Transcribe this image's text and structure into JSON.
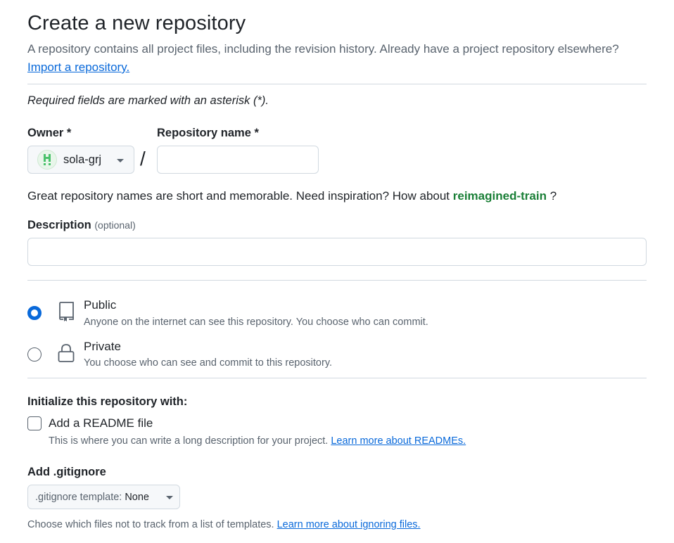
{
  "header": {
    "title": "Create a new repository",
    "subtitle": "A repository contains all project files, including the revision history. Already have a project repository elsewhere?",
    "import_link": "Import a repository."
  },
  "required_note": "Required fields are marked with an asterisk (*).",
  "owner": {
    "label": "Owner *",
    "value": "sola-grj",
    "avatar_color": "#4ac26b"
  },
  "separator": "/",
  "repo_name": {
    "label": "Repository name *",
    "value": "",
    "placeholder": ""
  },
  "suggestion": {
    "prefix": "Great repository names are short and memorable. Need inspiration? How about",
    "name": "reimagined-train",
    "suffix": "?"
  },
  "description": {
    "label": "Description",
    "optional": "(optional)",
    "value": ""
  },
  "visibility": {
    "selected": "public",
    "options": [
      {
        "id": "public",
        "title": "Public",
        "description": "Anyone on the internet can see this repository. You choose who can commit.",
        "icon": "repo-icon"
      },
      {
        "id": "private",
        "title": "Private",
        "description": "You choose who can see and commit to this repository.",
        "icon": "lock-icon"
      }
    ]
  },
  "initialize": {
    "label": "Initialize this repository with:",
    "readme": {
      "label": "Add a README file",
      "checked": false,
      "description": "This is where you can write a long description for your project.",
      "link": "Learn more about READMEs."
    }
  },
  "gitignore": {
    "label": "Add .gitignore",
    "button_prefix": ".gitignore template:",
    "button_value": "None",
    "description": "Choose which files not to track from a list of templates.",
    "link": "Learn more about ignoring files."
  },
  "colors": {
    "accent": "#0969da",
    "suggestion_green": "#1a7f37",
    "muted_text": "#59636e",
    "border": "#d1d9e0"
  }
}
